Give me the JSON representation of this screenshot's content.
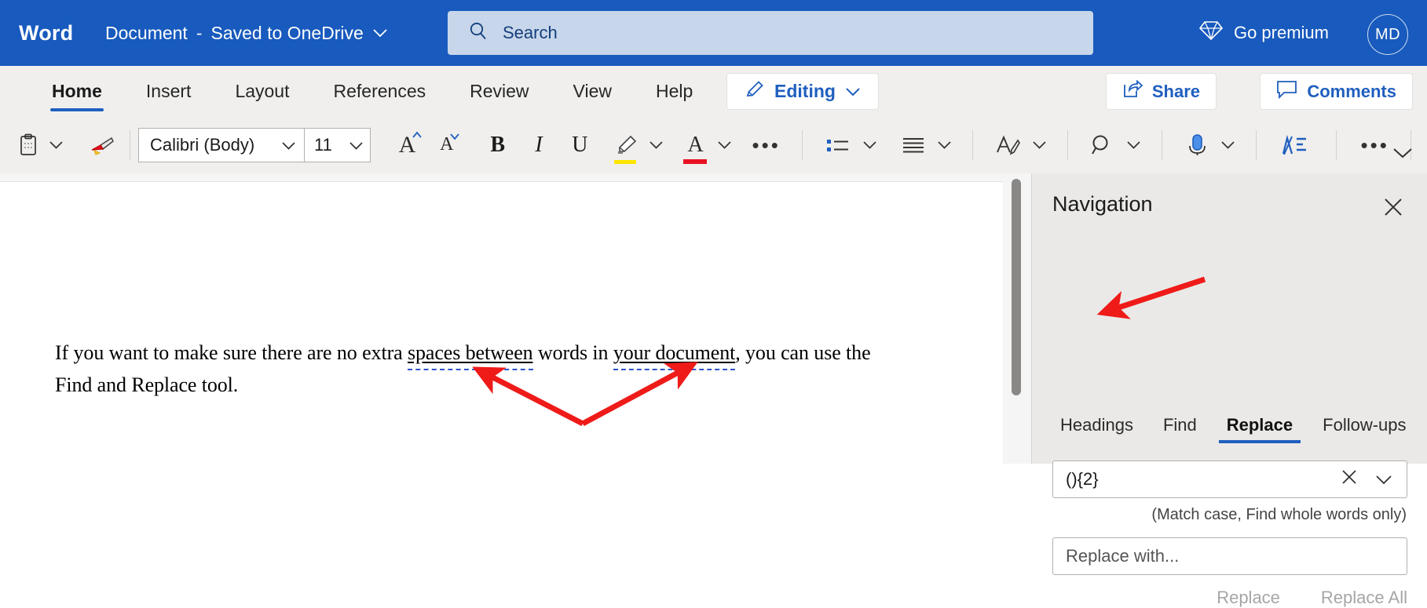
{
  "titlebar": {
    "app_name": "Word",
    "doc_name": "Document",
    "separator": "-",
    "save_status": "Saved to OneDrive",
    "search_placeholder": "Search",
    "search_icon": "search-icon",
    "go_premium_label": "Go premium",
    "go_premium_icon": "diamond-icon",
    "avatar_initials": "MD"
  },
  "ribbon": {
    "tabs": [
      {
        "label": "Home",
        "active": true
      },
      {
        "label": "Insert",
        "active": false
      },
      {
        "label": "Layout",
        "active": false
      },
      {
        "label": "References",
        "active": false
      },
      {
        "label": "Review",
        "active": false
      },
      {
        "label": "View",
        "active": false
      },
      {
        "label": "Help",
        "active": false
      }
    ],
    "editing_label": "Editing",
    "editing_icon": "pencil-icon",
    "share_label": "Share",
    "share_icon": "share-icon",
    "comments_label": "Comments",
    "comments_icon": "comment-icon"
  },
  "toolbar": {
    "font_name": "Calibri (Body)",
    "font_size": "11",
    "icons": [
      "paste-clipboard-icon",
      "format-painter-icon",
      "grow-font-icon",
      "shrink-font-icon",
      "bold-icon",
      "italic-icon",
      "underline-icon",
      "highlight-icon",
      "font-color-icon",
      "more-font-options-icon",
      "bullets-icon",
      "align-icon",
      "styles-icon",
      "find-icon",
      "dictate-icon",
      "editor-icon",
      "more-options-icon",
      "collapse-ribbon-icon"
    ],
    "bold_glyph": "B",
    "italic_glyph": "I",
    "underline_glyph": "U",
    "grow_glyph": "A",
    "shrink_glyph": "A",
    "font_color_glyph": "A",
    "ellipsis": "•••",
    "highlight_color": "#FFE600",
    "font_color": "#E81123"
  },
  "document": {
    "line1_before": "If you want to make sure there are no extra ",
    "match1": "spaces  between",
    "line1_mid": " words in ",
    "match2": "your  document",
    "line1_after": ", you can use the",
    "line2": "Find and Replace tool."
  },
  "navigation": {
    "title": "Navigation",
    "close_icon": "close-icon",
    "tabs": [
      {
        "label": "Headings",
        "active": false
      },
      {
        "label": "Find",
        "active": false
      },
      {
        "label": "Replace",
        "active": true
      },
      {
        "label": "Follow-ups",
        "active": false
      }
    ],
    "find_value": "(){2}",
    "find_clear_icon": "clear-icon",
    "find_dropdown_icon": "chevron-down-icon",
    "match_note": "(Match case, Find whole words only)",
    "replace_placeholder": "Replace with...",
    "replace_button": "Replace",
    "replace_all_button": "Replace All"
  },
  "annotations": {
    "arrow_color": "#EE1B19",
    "arrow_count": 3
  }
}
